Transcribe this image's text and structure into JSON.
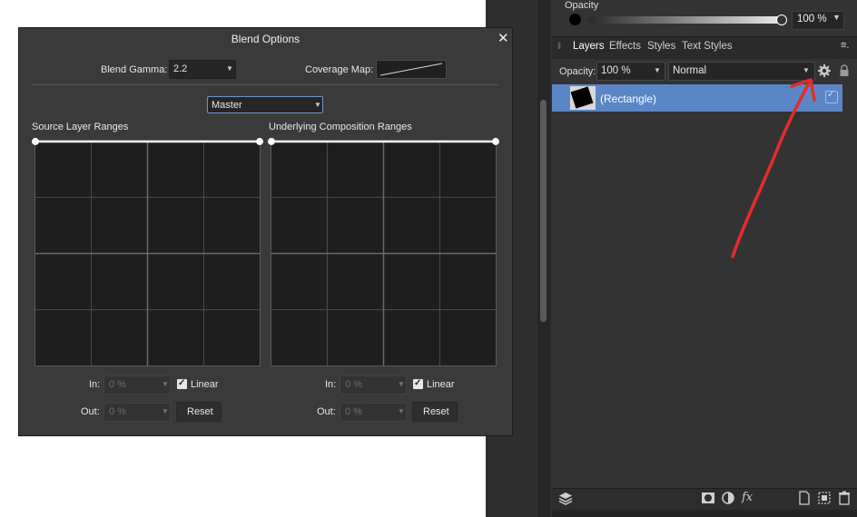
{
  "colors": {
    "accent_selection": "#5a86c6",
    "annotation_arrow": "#e32c2c",
    "dialog_bg": "#3a3a3a"
  },
  "studio": {
    "opacity_label": "Opacity",
    "opacity_value": "100 %",
    "opacity_level_percent": 100,
    "tabs": [
      "Layers",
      "Effects",
      "Styles",
      "Text Styles"
    ],
    "layers": {
      "opacity_label": "Opacity:",
      "opacity_value": "100 %",
      "blend_mode": "Normal",
      "items": [
        {
          "name": "(Rectangle)",
          "visible": true,
          "selected": true
        }
      ]
    },
    "icons": [
      "panel-grip-icon",
      "panel-menu-icon",
      "gear-icon",
      "lock-icon",
      "layers-stack-icon",
      "mask-icon",
      "adjustment-icon",
      "fx-icon",
      "add-layer-icon",
      "group-icon",
      "trash-icon"
    ],
    "fx_label": "fx"
  },
  "dialog": {
    "title": "Blend Options",
    "close_glyph": "✕",
    "blend_gamma_label": "Blend Gamma:",
    "blend_gamma_value": "2.2",
    "coverage_map_label": "Coverage Map:",
    "channel": "Master",
    "source_label": "Source Layer Ranges",
    "underlying_label": "Underlying Composition Ranges",
    "in_label": "In:",
    "out_label": "Out:",
    "linear_label": "Linear",
    "reset_label": "Reset",
    "source": {
      "in_value": "0 %",
      "out_value": "0 %",
      "linear": true
    },
    "underlying": {
      "in_value": "0 %",
      "out_value": "0 %",
      "linear": true
    }
  }
}
